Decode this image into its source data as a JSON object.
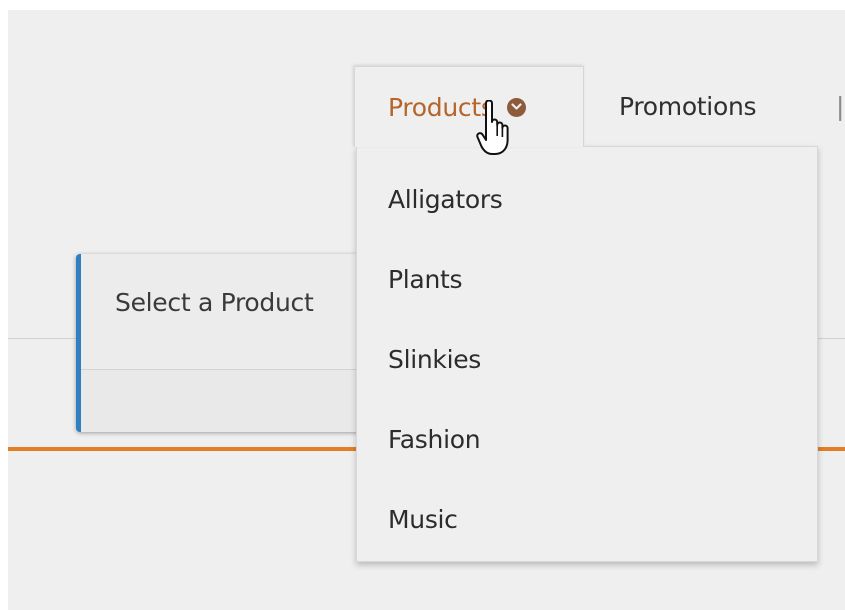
{
  "nav": {
    "tabs": [
      {
        "label": "Products",
        "active": true,
        "icon": "chevron-down-circle-icon"
      },
      {
        "label": "Promotions",
        "active": false
      }
    ],
    "active_color": "#b5652a"
  },
  "dropdown": {
    "items": [
      {
        "label": "Alligators"
      },
      {
        "label": "Plants"
      },
      {
        "label": "Slinkies"
      },
      {
        "label": "Fashion"
      },
      {
        "label": "Music"
      }
    ]
  },
  "card": {
    "title": "Select a Product",
    "accent_color": "#2f7fc1"
  },
  "page": {
    "divider_color": "#e07f25"
  },
  "cursor": {
    "icon": "hand-pointer-icon"
  }
}
